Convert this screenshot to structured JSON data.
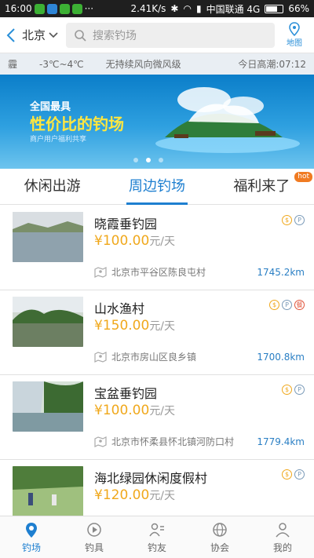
{
  "status_bar": {
    "time": "16:00",
    "speed": "2.41K/s",
    "carrier": "中国联通 4G",
    "battery": "66%",
    "battery_level": 0.66
  },
  "header": {
    "city": "北京",
    "search_placeholder": "搜索钓场",
    "map_label": "地图"
  },
  "weather": {
    "condition": "霾",
    "temp": "-3℃~4℃",
    "wind": "无持续风向微风级",
    "tide": "今日高潮:07:12"
  },
  "banner": {
    "line1": "全国最具",
    "line2": "性价比的钓场",
    "line3": "商户用户福利共享",
    "dot_count": 3,
    "active_dot": 1
  },
  "tabs": [
    {
      "label": "休闲出游",
      "active": false
    },
    {
      "label": "周边钓场",
      "active": true
    },
    {
      "label": "福利来了",
      "active": false,
      "badge": "hot"
    }
  ],
  "spots": [
    {
      "name": "晓霞垂钓园",
      "price": "¥100.00",
      "unit": "元/天",
      "address": "北京市平谷区陈良屯村",
      "distance": "1745.2km",
      "badges": [
        "$",
        "P"
      ]
    },
    {
      "name": "山水渔村",
      "price": "¥150.00",
      "unit": "元/天",
      "address": "北京市房山区良乡镇",
      "distance": "1700.8km",
      "badges": [
        "$",
        "P",
        "餐"
      ]
    },
    {
      "name": "宝盆垂钓园",
      "price": "¥100.00",
      "unit": "元/天",
      "address": "北京市怀柔县怀北镇河防口村",
      "distance": "1779.4km",
      "badges": [
        "$",
        "P"
      ]
    },
    {
      "name": "海北绿园休闲度假村",
      "price": "¥120.00",
      "unit": "元/天",
      "address": "",
      "distance": "",
      "badges": [
        "$",
        "P"
      ]
    }
  ],
  "nav": [
    {
      "label": "钓场",
      "icon": "location-pin-icon",
      "active": true
    },
    {
      "label": "钓具",
      "icon": "fishing-gear-icon",
      "active": false
    },
    {
      "label": "钓友",
      "icon": "friends-icon",
      "active": false
    },
    {
      "label": "协会",
      "icon": "globe-icon",
      "active": false
    },
    {
      "label": "我的",
      "icon": "user-icon",
      "active": false
    }
  ],
  "colors": {
    "accent": "#1e7fd0",
    "price": "#f0a81c",
    "hot": "#f07b22"
  }
}
